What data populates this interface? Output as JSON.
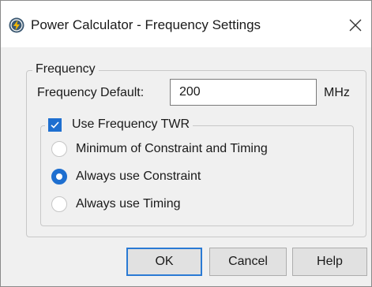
{
  "window": {
    "title": "Power Calculator - Frequency Settings",
    "app_icon": "power-calculator-icon",
    "close_icon": "close-icon"
  },
  "frequency_group": {
    "legend": "Frequency",
    "default_label": "Frequency Default:",
    "default_value": "200",
    "unit": "MHz"
  },
  "twr_group": {
    "checkbox_label": "Use Frequency TWR",
    "checked": true,
    "options": [
      {
        "label": "Minimum of Constraint and Timing",
        "selected": false
      },
      {
        "label": "Always use Constraint",
        "selected": true
      },
      {
        "label": "Always use Timing",
        "selected": false
      }
    ]
  },
  "buttons": {
    "ok": "OK",
    "cancel": "Cancel",
    "help": "Help"
  },
  "colors": {
    "accent": "#1e6fd0",
    "background": "#f0f0f0",
    "titlebar": "#ffffff",
    "icon_dark": "#3d5a73",
    "icon_lightning": "#f5b800"
  }
}
